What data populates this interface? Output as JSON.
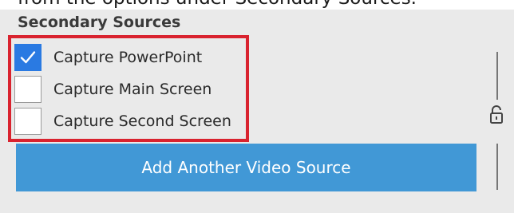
{
  "top_caption": "from the options under Secondary Sources.",
  "section": {
    "heading": "Secondary Sources"
  },
  "options": [
    {
      "label": "Capture PowerPoint",
      "checked": true
    },
    {
      "label": "Capture Main Screen",
      "checked": false
    },
    {
      "label": "Capture Second Screen",
      "checked": false
    }
  ],
  "add_button": {
    "label": "Add Another Video Source"
  },
  "icons": {
    "check": "check-icon",
    "lock": "lock-icon"
  },
  "colors": {
    "highlight": "#d9232f",
    "checkbox_checked": "#2a7ae2",
    "button": "#4198d6",
    "background": "#eaeaea"
  }
}
